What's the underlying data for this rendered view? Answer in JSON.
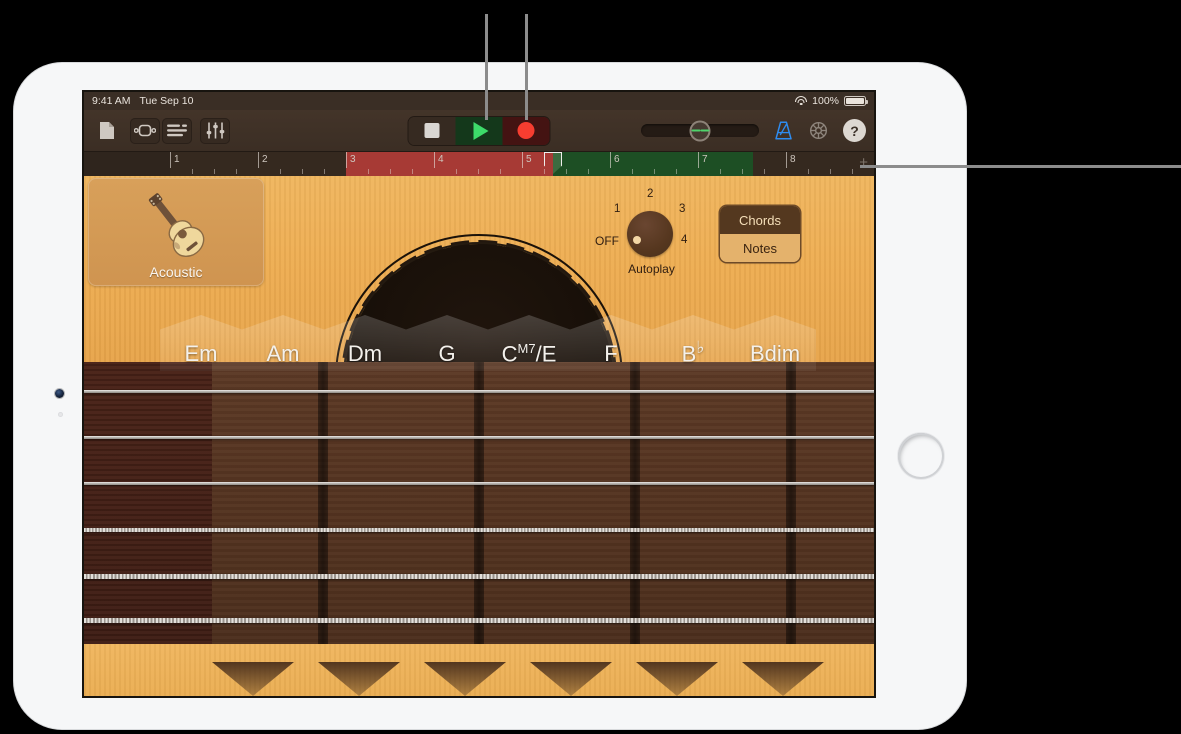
{
  "status_bar": {
    "time": "9:41 AM",
    "date": "Tue Sep 10",
    "wifi_icon": "wifi-icon",
    "battery_percent": "100%",
    "battery_icon": "battery-icon"
  },
  "toolbar": {
    "left_buttons": [
      {
        "name": "document-icon",
        "label": "My Songs"
      },
      {
        "name": "loop-browser-icon",
        "label": "Loop Browser"
      },
      {
        "name": "tracks-view-icon",
        "label": "Tracks View"
      },
      {
        "name": "mixer-icon",
        "label": "Track Controls"
      }
    ],
    "transport": {
      "stop_label": "Stop",
      "play_label": "Play",
      "record_label": "Record",
      "stop_icon": "stop-icon",
      "play_icon": "play-icon",
      "record_icon": "record-icon",
      "play_bg": "#14381b",
      "record_bg": "#441312",
      "play_accent": "#3ddb6a",
      "record_accent": "#f73d30"
    },
    "master_volume_label": "Master Volume",
    "metronome_label": "Metronome",
    "metronome_color": "#2e8cf0",
    "settings_label": "Song Settings",
    "help_label": "?"
  },
  "ruler": {
    "bars": [
      "1",
      "2",
      "3",
      "4",
      "5",
      "6",
      "7",
      "8"
    ],
    "colors": {
      "empty": "#35291f",
      "recorded": "#a73a35",
      "section": "#1d4f24"
    },
    "playhead_position_bar": "5.5",
    "add_section_label": "+"
  },
  "instrument": {
    "name": "Acoustic",
    "icon": "acoustic-guitar-icon",
    "autoplay": {
      "title": "Autoplay",
      "positions": [
        "OFF",
        "1",
        "2",
        "3",
        "4"
      ],
      "selected": "OFF"
    },
    "mode_switch": {
      "options": [
        "Chords",
        "Notes"
      ],
      "selected": "Chords"
    },
    "chords": [
      {
        "root": "Em",
        "sup": "",
        "suffix": ""
      },
      {
        "root": "Am",
        "sup": "",
        "suffix": ""
      },
      {
        "root": "Dm",
        "sup": "",
        "suffix": ""
      },
      {
        "root": "G",
        "sup": "",
        "suffix": ""
      },
      {
        "root": "C",
        "sup": "M7",
        "suffix": "/E"
      },
      {
        "root": "F",
        "sup": "",
        "suffix": ""
      },
      {
        "root": "B",
        "sup": "♭",
        "suffix": ""
      },
      {
        "root": "Bdim",
        "sup": "",
        "suffix": ""
      }
    ],
    "string_count": 6,
    "fret_count": 4
  },
  "callouts": {
    "play_button_line": "callout-play",
    "record_button_line": "callout-record",
    "ruler_line": "callout-ruler"
  }
}
